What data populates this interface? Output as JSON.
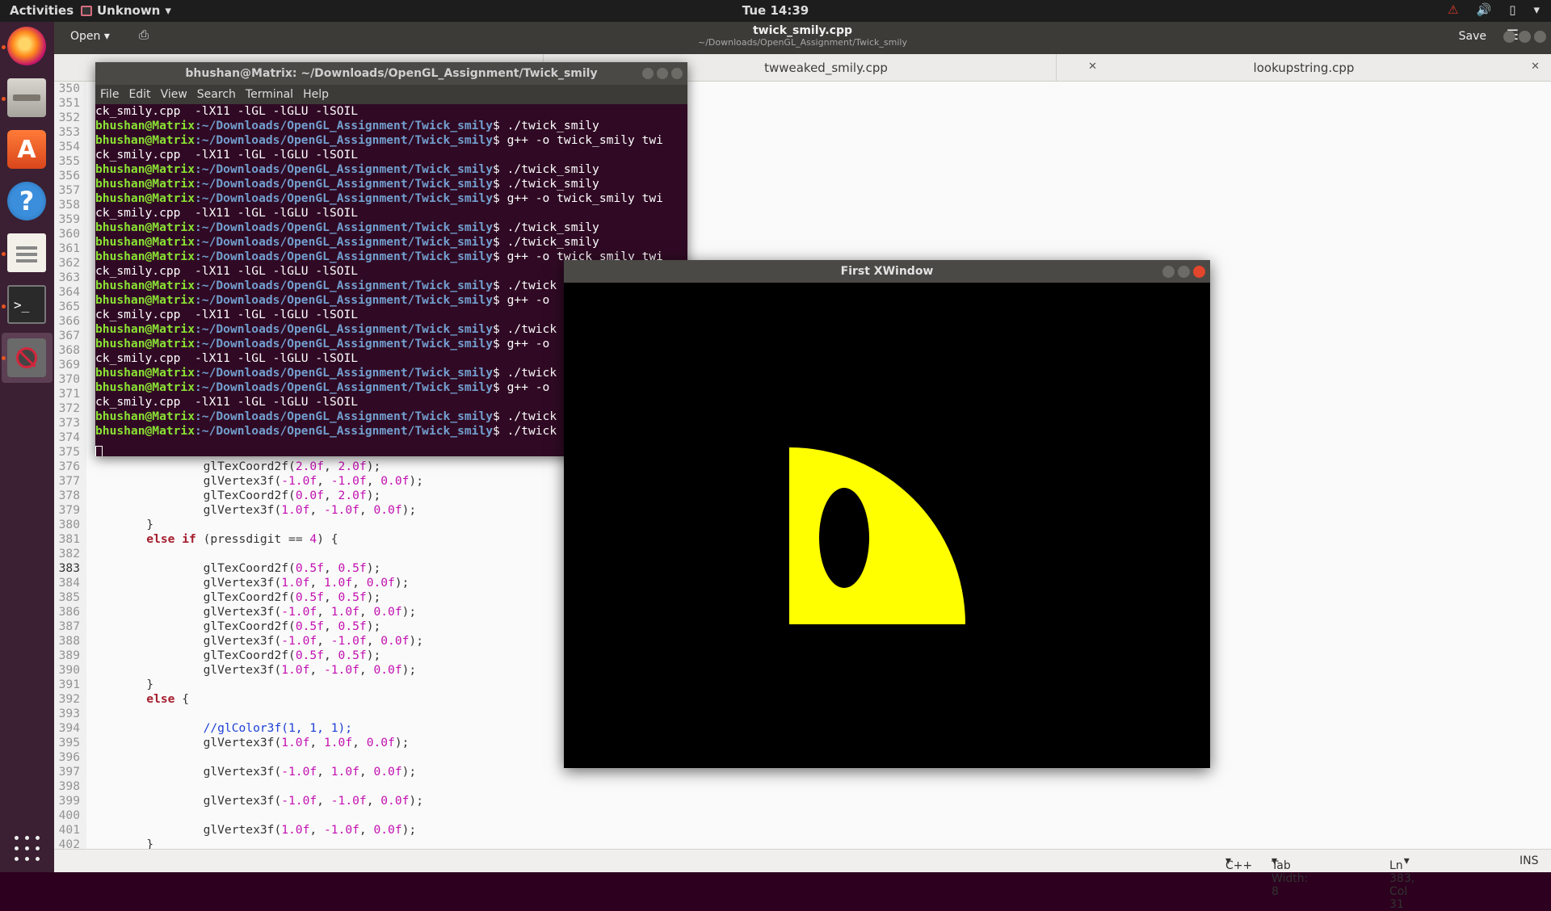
{
  "topbar": {
    "activities": "Activities",
    "app_name": "Unknown",
    "clock": "Tue 14:39"
  },
  "gedit": {
    "open_label": "Open",
    "title": "twick_smily.cpp",
    "subtitle": "~/Downloads/OpenGL_Assignment/Twick_smily",
    "save_label": "Save",
    "tabs": [
      {
        "label": "twweaked_smily.cpp"
      },
      {
        "label": "lookupstring.cpp"
      }
    ],
    "status": {
      "language": "C++",
      "tab_width": "Tab Width: 8",
      "position": "Ln 383, Col 31",
      "mode": "INS"
    },
    "lines": [
      {
        "n": "350",
        "t": ""
      },
      {
        "n": "351",
        "t": ""
      },
      {
        "n": "352",
        "t": ""
      },
      {
        "n": "353",
        "t": ""
      },
      {
        "n": "354",
        "t": ""
      },
      {
        "n": "355",
        "t": ""
      },
      {
        "n": "356",
        "t": ""
      },
      {
        "n": "357",
        "t": ""
      },
      {
        "n": "358",
        "t": ""
      },
      {
        "n": "359",
        "t": ""
      },
      {
        "n": "360",
        "t": ""
      },
      {
        "n": "361",
        "t": ""
      },
      {
        "n": "362",
        "t": ""
      },
      {
        "n": "363",
        "t": ""
      },
      {
        "n": "364",
        "t": ""
      },
      {
        "n": "365",
        "t": ""
      },
      {
        "n": "366",
        "t": ""
      },
      {
        "n": "367",
        "t": ""
      },
      {
        "n": "368",
        "t": ""
      },
      {
        "n": "369",
        "t": ""
      },
      {
        "n": "370",
        "t": ""
      },
      {
        "n": "371",
        "t": ""
      },
      {
        "n": "372",
        "t": ""
      },
      {
        "n": "373",
        "t": ""
      },
      {
        "n": "374",
        "t": ""
      },
      {
        "n": "375",
        "t": ""
      },
      {
        "n": "376",
        "t": "                glTexCoord2f(2.0f, 2.0f);"
      },
      {
        "n": "377",
        "t": "                glVertex3f(-1.0f, -1.0f, 0.0f);"
      },
      {
        "n": "378",
        "t": "                glTexCoord2f(0.0f, 2.0f);"
      },
      {
        "n": "379",
        "t": "                glVertex3f(1.0f, -1.0f, 0.0f);"
      },
      {
        "n": "380",
        "t": "        }"
      },
      {
        "n": "381",
        "t": "        else if (pressdigit == 4) {"
      },
      {
        "n": "382",
        "t": ""
      },
      {
        "n": "383",
        "t": "                glTexCoord2f(0.5f, 0.5f);"
      },
      {
        "n": "384",
        "t": "                glVertex3f(1.0f, 1.0f, 0.0f);"
      },
      {
        "n": "385",
        "t": "                glTexCoord2f(0.5f, 0.5f);"
      },
      {
        "n": "386",
        "t": "                glVertex3f(-1.0f, 1.0f, 0.0f);"
      },
      {
        "n": "387",
        "t": "                glTexCoord2f(0.5f, 0.5f);"
      },
      {
        "n": "388",
        "t": "                glVertex3f(-1.0f, -1.0f, 0.0f);"
      },
      {
        "n": "389",
        "t": "                glTexCoord2f(0.5f, 0.5f);"
      },
      {
        "n": "390",
        "t": "                glVertex3f(1.0f, -1.0f, 0.0f);"
      },
      {
        "n": "391",
        "t": "        }"
      },
      {
        "n": "392",
        "t": "        else {"
      },
      {
        "n": "393",
        "t": ""
      },
      {
        "n": "394",
        "t": "                //glColor3f(1, 1, 1);"
      },
      {
        "n": "395",
        "t": "                glVertex3f(1.0f, 1.0f, 0.0f);"
      },
      {
        "n": "396",
        "t": ""
      },
      {
        "n": "397",
        "t": "                glVertex3f(-1.0f, 1.0f, 0.0f);"
      },
      {
        "n": "398",
        "t": ""
      },
      {
        "n": "399",
        "t": "                glVertex3f(-1.0f, -1.0f, 0.0f);"
      },
      {
        "n": "400",
        "t": ""
      },
      {
        "n": "401",
        "t": "                glVertex3f(1.0f, -1.0f, 0.0f);"
      },
      {
        "n": "402",
        "t": "        }"
      }
    ]
  },
  "terminal": {
    "title": "bhushan@Matrix: ~/Downloads/OpenGL_Assignment/Twick_smily",
    "menu": [
      "File",
      "Edit",
      "View",
      "Search",
      "Terminal",
      "Help"
    ],
    "user": "bhushan@Matrix",
    "path": ":~/Downloads/OpenGL_Assignment/Twick_smily",
    "lines": [
      {
        "cont": "ck_smily.cpp  -lX11 -lGL -lGLU -lSOIL"
      },
      {
        "cmd": "$ ./twick_smily"
      },
      {
        "cmd": "$ g++ -o twick_smily twi"
      },
      {
        "cont": "ck_smily.cpp  -lX11 -lGL -lGLU -lSOIL"
      },
      {
        "cmd": "$ ./twick_smily"
      },
      {
        "cmd": "$ ./twick_smily"
      },
      {
        "cmd": "$ g++ -o twick_smily twi"
      },
      {
        "cont": "ck_smily.cpp  -lX11 -lGL -lGLU -lSOIL"
      },
      {
        "cmd": "$ ./twick_smily"
      },
      {
        "cmd": "$ ./twick_smily"
      },
      {
        "cmd": "$ g++ -o twick_smily twi"
      },
      {
        "cont": "ck_smily.cpp  -lX11 -lGL -lGLU -lSOIL"
      },
      {
        "cmd": "$ ./twick"
      },
      {
        "cmd": "$ g++ -o"
      },
      {
        "cont": "ck_smily.cpp  -lX11 -lGL -lGLU -lSOIL"
      },
      {
        "cmd": "$ ./twick"
      },
      {
        "cmd": "$ g++ -o"
      },
      {
        "cont": "ck_smily.cpp  -lX11 -lGL -lGLU -lSOIL"
      },
      {
        "cmd": "$ ./twick"
      },
      {
        "cmd": "$ g++ -o"
      },
      {
        "cont": "ck_smily.cpp  -lX11 -lGL -lGLU -lSOIL"
      },
      {
        "cmd": "$ ./twick"
      },
      {
        "cmd": "$ ./twick"
      }
    ]
  },
  "xwindow": {
    "title": "First XWindow",
    "colors": {
      "background": "#000000",
      "face": "#ffff00",
      "eye": "#000000"
    }
  }
}
